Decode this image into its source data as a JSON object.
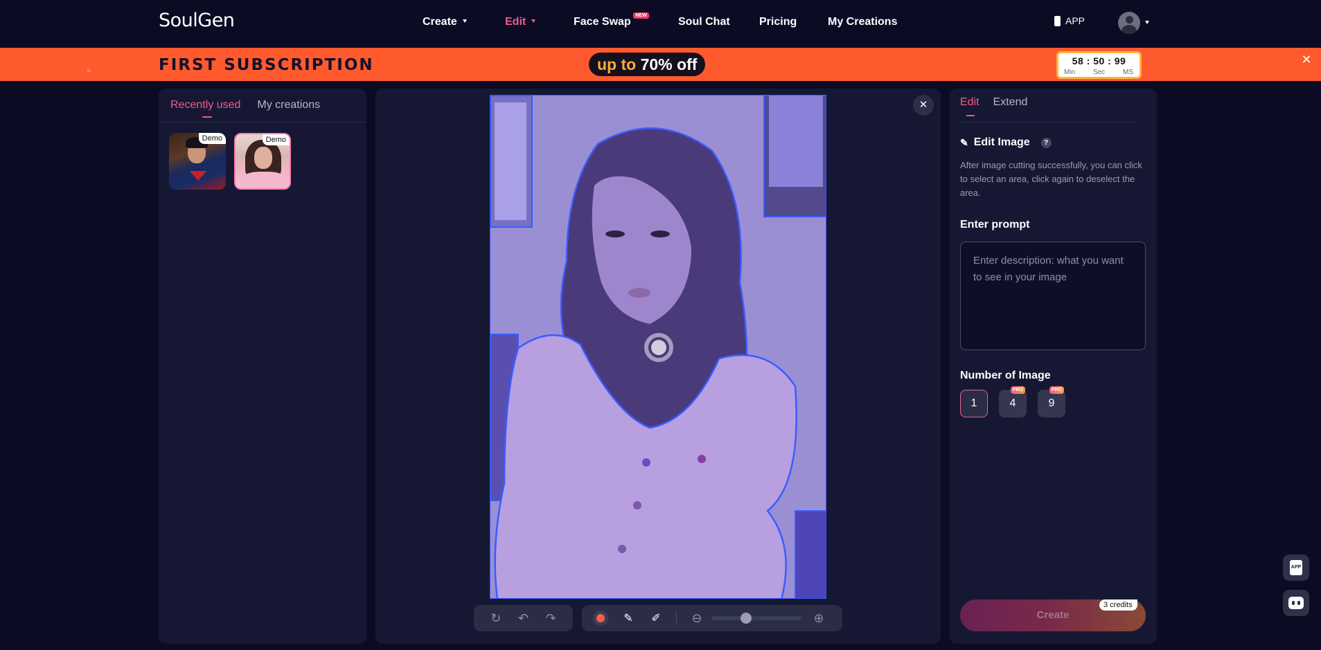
{
  "nav": {
    "logo": "SoulGen",
    "items": [
      {
        "label": "Create"
      },
      {
        "label": "Edit"
      },
      {
        "label": "Face Swap",
        "badge": "NEW"
      },
      {
        "label": "Soul Chat"
      },
      {
        "label": "Pricing"
      },
      {
        "label": "My Creations"
      }
    ],
    "app_label": "APP"
  },
  "promo": {
    "title": "FIRST SUBSCRIPTION",
    "up_to": "up to",
    "discount": "70% off",
    "timer": {
      "min": "58",
      "sec": "50",
      "ms": "99",
      "sep": ":",
      "min_label": "Min",
      "sec_label": "Sec",
      "ms_label": "MS"
    }
  },
  "left_panel": {
    "tabs": [
      "Recently used",
      "My creations"
    ],
    "thumbnails": [
      {
        "badge": "Demo"
      },
      {
        "badge": "Demo"
      }
    ]
  },
  "right_panel": {
    "tabs": [
      "Edit",
      "Extend"
    ],
    "edit_title": "Edit Image",
    "help": "?",
    "description": "After image cutting successfully, you can click to select an area, click again to deselect the area.",
    "prompt_label": "Enter prompt",
    "prompt_placeholder": "Enter description: what you want to see in your image",
    "prompt_value": "",
    "number_label": "Number of Image",
    "options": [
      {
        "value": "1",
        "selected": true
      },
      {
        "value": "4",
        "badge": "PRO"
      },
      {
        "value": "9",
        "badge": "PRO"
      }
    ],
    "create_label": "Create",
    "credits": "3 credits"
  },
  "float": {
    "app_label": "APP"
  },
  "colors": {
    "background": "#0b0b24",
    "panel": "#161833",
    "accent": "#f45a8a",
    "promo": "#ff5a2d",
    "brush": "#ff5a4a",
    "mask_outline": "#3a5cff"
  }
}
